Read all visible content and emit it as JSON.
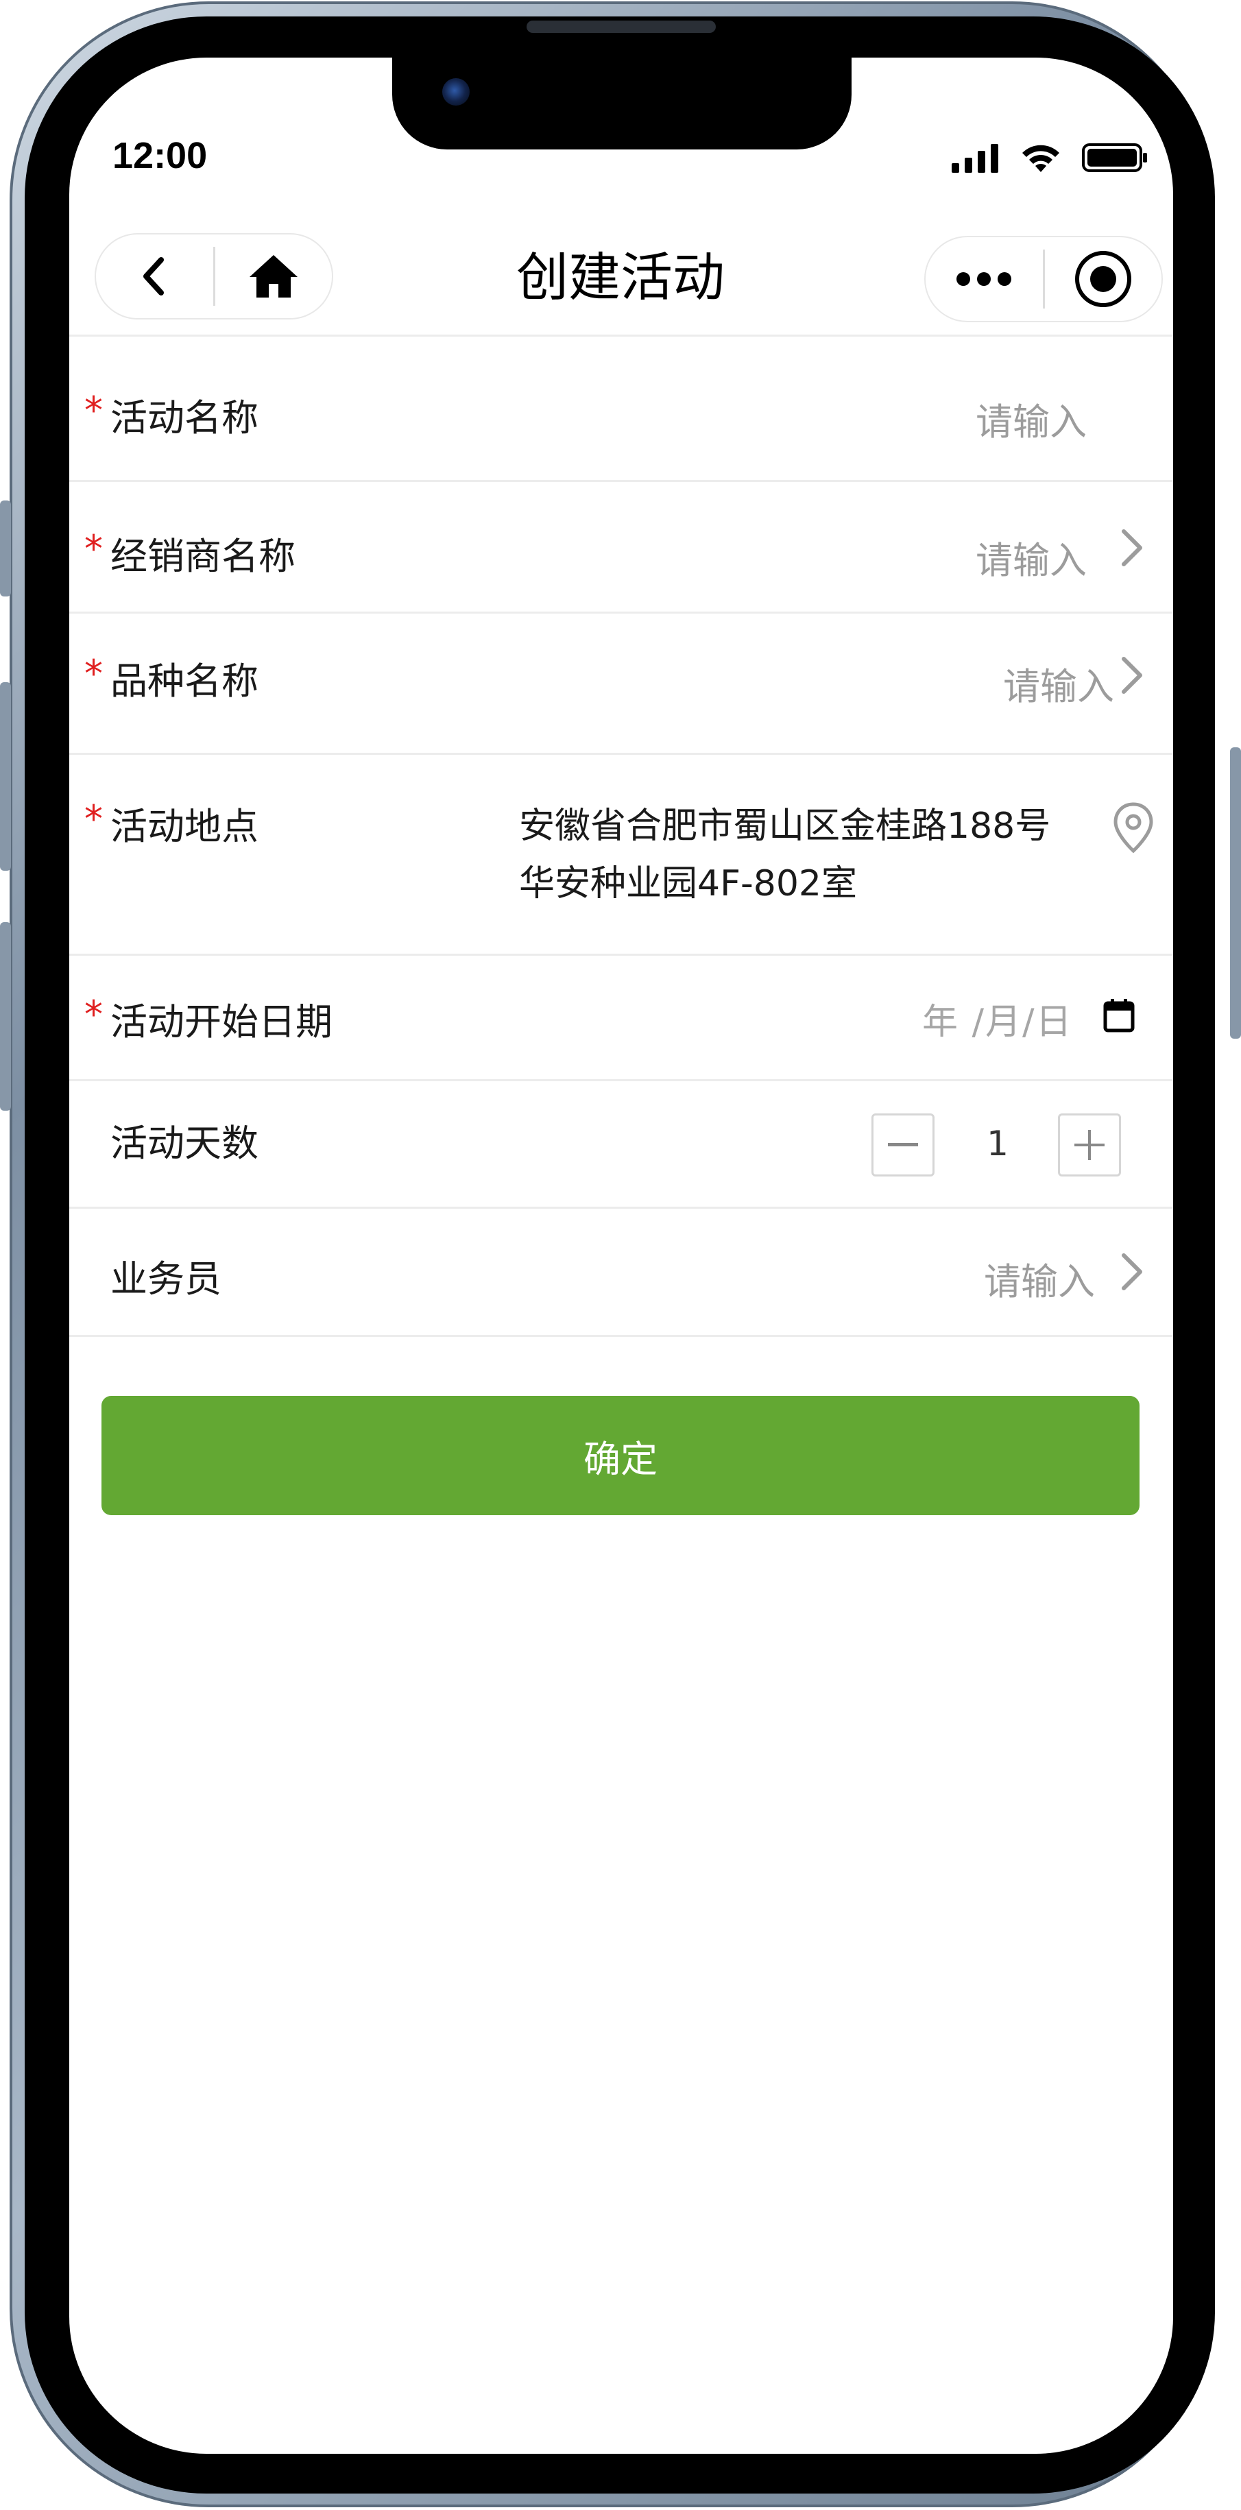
{
  "status_bar": {
    "time": "12:00"
  },
  "nav": {
    "title": "创建活动",
    "icons": [
      "back-icon",
      "home-icon",
      "more-icon",
      "record-icon"
    ]
  },
  "form": {
    "activity_name": {
      "label": "活动名称",
      "required_mark": "*",
      "placeholder": "请输入"
    },
    "dealer_name": {
      "label": "经销商名称",
      "required_mark": "*",
      "placeholder": "请输入"
    },
    "variety_name": {
      "label": "品种名称",
      "required_mark": "*",
      "placeholder": "请输入"
    },
    "activity_location": {
      "label": "活动地点",
      "required_mark": "*",
      "address_line1": "安徽省合肥市蜀山区金桂路188号",
      "address_line2": "华安种业园4F-802室"
    },
    "start_date": {
      "label": "活动开始日期",
      "required_mark": "*",
      "placeholder": "年 /月/日"
    },
    "activity_days": {
      "label": "活动天数",
      "value": "1"
    },
    "salesperson": {
      "label": "业务员",
      "placeholder": "请输入"
    }
  },
  "actions": {
    "confirm_label": "确定"
  },
  "colors": {
    "primary_button": "#63a833",
    "required": "#e02020",
    "placeholder": "#9c9c9c"
  }
}
